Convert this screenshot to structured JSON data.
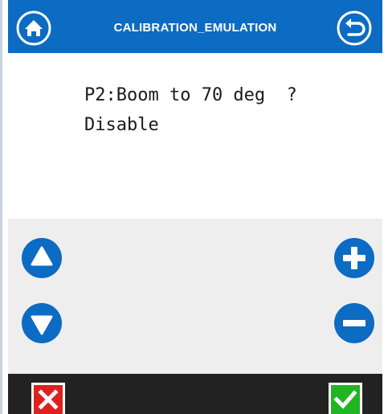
{
  "header": {
    "title": "CALIBRATION_EMULATION",
    "home_icon": "home-icon",
    "back_icon": "back-arrow-icon"
  },
  "message": {
    "line1": "P2:Boom to 70 deg  ?",
    "line2": "Disable"
  },
  "controls": {
    "up_icon": "up-arrow-icon",
    "down_icon": "down-arrow-icon",
    "plus_icon": "plus-icon",
    "minus_icon": "minus-icon"
  },
  "footer": {
    "cancel_icon": "close-icon",
    "confirm_icon": "check-icon"
  },
  "colors": {
    "header_blue": "#0c6bc2",
    "button_blue": "#0c6bc2",
    "control_bg": "#eeeeee",
    "footer_bg": "#222222",
    "cancel_red": "#e02020",
    "confirm_green": "#22b522"
  }
}
